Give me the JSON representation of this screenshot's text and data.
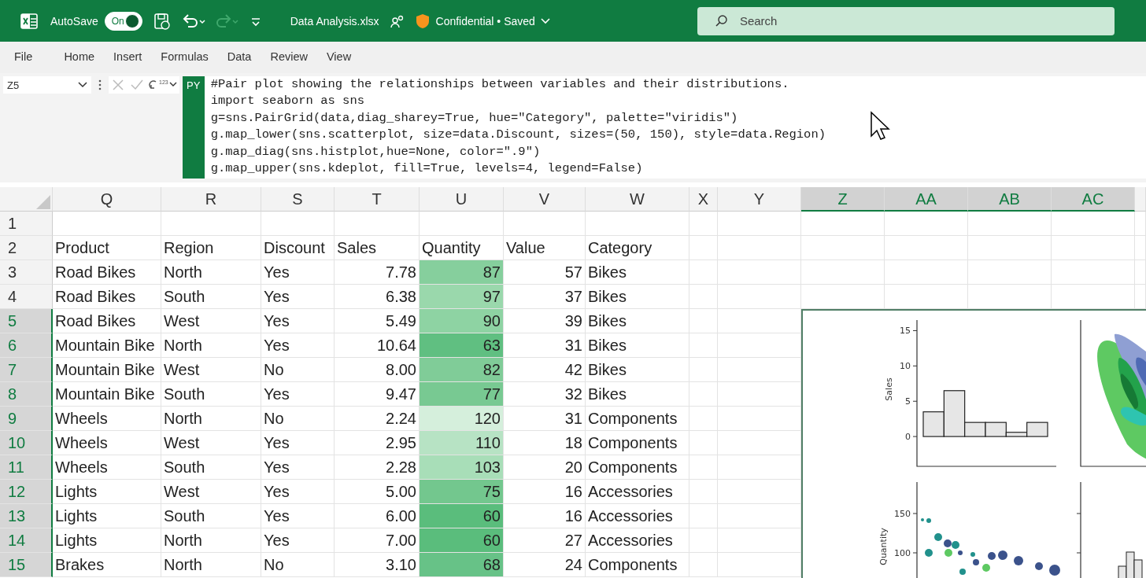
{
  "title_bar": {
    "autosave_label": "AutoSave",
    "autosave_toggle": {
      "label": "On",
      "on": true
    },
    "file_name": "Data Analysis.xlsx",
    "status": "Confidential • Saved",
    "search": {
      "placeholder": "Search"
    }
  },
  "menu": [
    {
      "label": "File",
      "selected": false
    },
    {
      "label": "Home",
      "selected": false
    },
    {
      "label": "Insert",
      "selected": false
    },
    {
      "label": "Formulas",
      "selected": false
    },
    {
      "label": "Data",
      "selected": false
    },
    {
      "label": "Review",
      "selected": false
    },
    {
      "label": "View",
      "selected": false
    }
  ],
  "formula_bar": {
    "name_box": "Z5",
    "output_icon_label": "123",
    "badge": "PY",
    "code_lines": [
      "#Pair plot showing the relationships between variables and their distributions.",
      "import seaborn as sns",
      "g=sns.PairGrid(data,diag_sharey=True, hue=\"Category\", palette=\"viridis\")",
      "g.map_lower(sns.scatterplot, size=data.Discount, sizes=(50, 150), style=data.Region)",
      "g.map_diag(sns.histplot,hue=None, color=\".9\")",
      "g.map_upper(sns.kdeplot, fill=True, levels=4, legend=False)"
    ]
  },
  "sheet": {
    "columns": [
      {
        "label": "Q",
        "selected": false
      },
      {
        "label": "R",
        "selected": false
      },
      {
        "label": "S",
        "selected": false
      },
      {
        "label": "T",
        "selected": false
      },
      {
        "label": "U",
        "selected": false
      },
      {
        "label": "V",
        "selected": false
      },
      {
        "label": "W",
        "selected": false
      },
      {
        "label": "X",
        "selected": false
      },
      {
        "label": "Y",
        "selected": false
      },
      {
        "label": "Z",
        "selected": true
      },
      {
        "label": "AA",
        "selected": true
      },
      {
        "label": "AB",
        "selected": true
      },
      {
        "label": "AC",
        "selected": true
      }
    ],
    "rows": [
      {
        "number": "1",
        "selected": false,
        "kind": "empty"
      },
      {
        "number": "2",
        "selected": false,
        "kind": "header",
        "cells": [
          "Product",
          "Region",
          "Discount",
          "Sales",
          "Quantity",
          "Value",
          "Category"
        ]
      },
      {
        "number": "3",
        "selected": false,
        "kind": "data",
        "cells": [
          "Road Bikes",
          "North",
          "Yes",
          "7.78",
          "87",
          "57",
          "Bikes"
        ],
        "color": "#86cf9d"
      },
      {
        "number": "4",
        "selected": false,
        "kind": "data",
        "cells": [
          "Road Bikes",
          "South",
          "Yes",
          "6.38",
          "97",
          "37",
          "Bikes"
        ],
        "color": "#9ad8ac"
      },
      {
        "number": "5",
        "selected": true,
        "kind": "data",
        "cells": [
          "Road Bikes",
          "West",
          "Yes",
          "5.49",
          "90",
          "39",
          "Bikes"
        ],
        "color": "#8ed3a3"
      },
      {
        "number": "6",
        "selected": true,
        "kind": "data",
        "cells": [
          "Mountain Bike",
          "North",
          "Yes",
          "10.64",
          "63",
          "31",
          "Bikes"
        ],
        "color": "#60bf81"
      },
      {
        "number": "7",
        "selected": true,
        "kind": "data",
        "cells": [
          "Mountain Bike",
          "West",
          "No",
          "8.00",
          "82",
          "42",
          "Bikes"
        ],
        "color": "#80cc98"
      },
      {
        "number": "8",
        "selected": true,
        "kind": "data",
        "cells": [
          "Mountain Bike",
          "South",
          "Yes",
          "9.47",
          "77",
          "32",
          "Bikes"
        ],
        "color": "#78c992"
      },
      {
        "number": "9",
        "selected": true,
        "kind": "data",
        "cells": [
          "Wheels",
          "North",
          "No",
          "2.24",
          "120",
          "31",
          "Components"
        ],
        "color": "#d5efdc"
      },
      {
        "number": "10",
        "selected": true,
        "kind": "data",
        "cells": [
          "Wheels",
          "West",
          "Yes",
          "2.95",
          "110",
          "18",
          "Components"
        ],
        "color": "#b7e3c4"
      },
      {
        "number": "11",
        "selected": true,
        "kind": "data",
        "cells": [
          "Wheels",
          "South",
          "Yes",
          "2.28",
          "103",
          "20",
          "Components"
        ],
        "color": "#a8deb8"
      },
      {
        "number": "12",
        "selected": true,
        "kind": "data",
        "cells": [
          "Lights",
          "West",
          "Yes",
          "5.00",
          "75",
          "16",
          "Accessories"
        ],
        "color": "#73c78e"
      },
      {
        "number": "13",
        "selected": true,
        "kind": "data",
        "cells": [
          "Lights",
          "South",
          "Yes",
          "6.00",
          "60",
          "16",
          "Accessories"
        ],
        "color": "#5abd7c"
      },
      {
        "number": "14",
        "selected": true,
        "kind": "data",
        "cells": [
          "Lights",
          "North",
          "Yes",
          "7.00",
          "60",
          "27",
          "Accessories"
        ],
        "color": "#5abd7c"
      },
      {
        "number": "15",
        "selected": true,
        "kind": "data",
        "cells": [
          "Brakes",
          "North",
          "No",
          "3.10",
          "68",
          "24",
          "Components"
        ],
        "color": "#67c287"
      }
    ]
  },
  "pair_plot": {
    "histogram": {
      "chart_data": {
        "type": "bar",
        "ylabel": "Sales",
        "values": [
          3.5,
          6.5,
          2,
          2,
          0.6,
          2
        ],
        "ylim": [
          -4,
          16.5
        ],
        "yticks": [
          0,
          5,
          10,
          15
        ]
      }
    },
    "scatter": {
      "ylabel": "Quantity",
      "yticks": [
        "150",
        "100"
      ]
    }
  }
}
